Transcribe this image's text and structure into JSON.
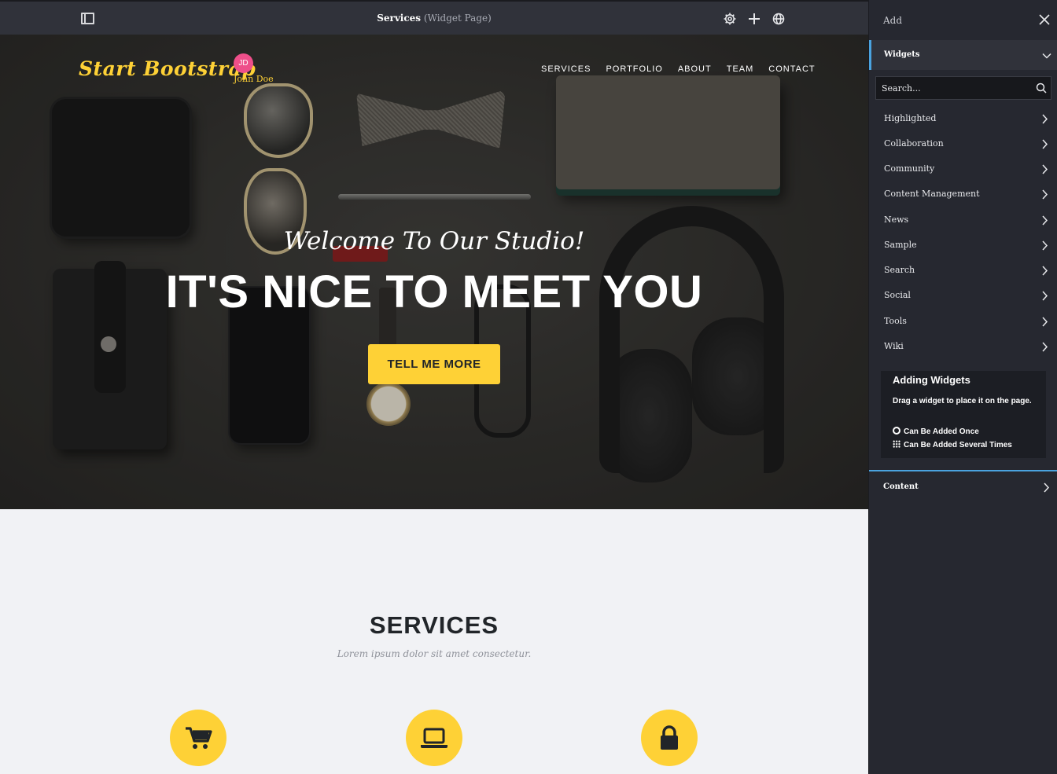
{
  "topbar": {
    "page_title": "Services",
    "page_type": "(Widget Page)",
    "icons": [
      "sidebar-toggle-icon",
      "gear-icon",
      "plus-icon",
      "globe-icon"
    ]
  },
  "site": {
    "brand": "Start Bootstrap",
    "user_initials": "JD",
    "user_name": "John Doe",
    "nav": [
      "SERVICES",
      "PORTFOLIO",
      "ABOUT",
      "TEAM",
      "CONTACT"
    ],
    "hero_subheading": "Welcome To Our Studio!",
    "hero_heading": "IT'S NICE TO MEET YOU",
    "hero_button": "TELL ME MORE",
    "services_title": "SERVICES",
    "services_subtitle": "Lorem ipsum dolor sit amet consectetur.",
    "service_icons": [
      "shopping-cart-icon",
      "laptop-icon",
      "lock-icon"
    ]
  },
  "panel": {
    "title": "Add",
    "section": "Widgets",
    "search_placeholder": "Search...",
    "categories": [
      "Highlighted",
      "Collaboration",
      "Community",
      "Content Management",
      "News",
      "Sample",
      "Search",
      "Social",
      "Tools",
      "Wiki"
    ],
    "info": {
      "title": "Adding Widgets",
      "description": "Drag a widget to place it on the page.",
      "once": "Can Be Added Once",
      "several": "Can Be Added Several Times"
    },
    "content_section": "Content"
  },
  "colors": {
    "accent": "#fed136",
    "topbar_bg": "#30323a",
    "panel_bg": "#262830",
    "panel_highlight": "#4aa3df",
    "avatar": "#ee4f8a"
  }
}
